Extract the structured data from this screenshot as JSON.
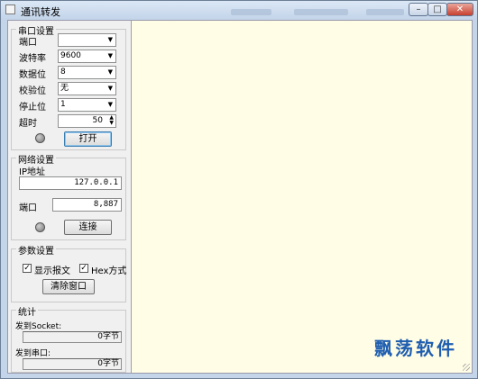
{
  "window": {
    "title": "通讯转发",
    "controls": {
      "minimize": "–",
      "maximize": "□",
      "close": "✕"
    }
  },
  "serial": {
    "group_title": "串口设置",
    "port_label": "端口",
    "port_value": "",
    "baud_label": "波特率",
    "baud_value": "9600",
    "databits_label": "数据位",
    "databits_value": "8",
    "parity_label": "校验位",
    "parity_value": "无",
    "stopbits_label": "停止位",
    "stopbits_value": "1",
    "timeout_label": "超时",
    "timeout_value": "50",
    "open_button": "打开"
  },
  "network": {
    "group_title": "网络设置",
    "ip_label": "IP地址",
    "ip_value": "127.0.0.1",
    "port_label": "端口",
    "port_value": "8,887",
    "connect_button": "连接"
  },
  "params": {
    "group_title": "参数设置",
    "show_message_label": "显示报文",
    "show_message_checked": true,
    "hex_label": "Hex方式",
    "hex_checked": true,
    "clear_button": "清除窗口"
  },
  "stats": {
    "group_title": "统计",
    "to_socket_label": "发到Socket:",
    "to_socket_value": "0字节",
    "to_serial_label": "发到串口:",
    "to_serial_value": "0字节"
  },
  "watermark": "飘荡软件",
  "colors": {
    "output_bg": "#fffde5",
    "watermark": "#1f5eb0"
  }
}
